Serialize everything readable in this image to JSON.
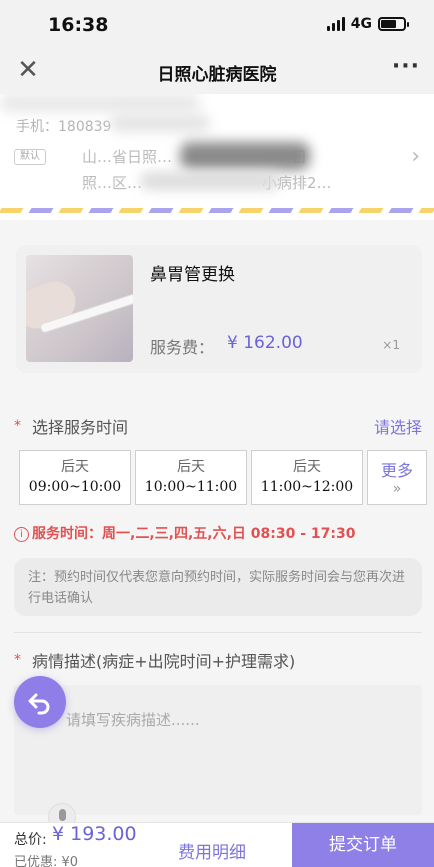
{
  "status_bar": {
    "time": "16:38",
    "network": "4G"
  },
  "nav": {
    "title": "日照心脏病医院",
    "more": "···",
    "close": "✕"
  },
  "address": {
    "phone": "手机：180839",
    "tag": "默认",
    "line1": "山…省日照…　　　　　　　　日",
    "line2": "照…区…　　　　　　　　小病排2…"
  },
  "service": {
    "name": "鼻胃管更换",
    "fee_label": "服务费：",
    "fee_value": "¥ 162.00",
    "quantity": "×1"
  },
  "time_section": {
    "title": "选择服务时间",
    "select": "请选择",
    "slots": [
      {
        "day": "后天",
        "time": "09:00~10:00"
      },
      {
        "day": "后天",
        "time": "10:00~11:00"
      },
      {
        "day": "后天",
        "time": "11:00~12:00"
      }
    ],
    "more_label": "更多",
    "more_arrow": "»"
  },
  "service_hours": {
    "icon": "i",
    "text": "服务时间：周一,二,三,四,五,六,日 08:30 - 17:30"
  },
  "notice": "注：预约时间仅代表您意向预约时间，实际服务时间会与您再次进行电话确认",
  "description": {
    "title": "病情描述(病症+出院时间+护理需求)",
    "placeholder": "请填写疾病描述......"
  },
  "bottom": {
    "total_label": "总价:",
    "total_value": "¥ 193.00",
    "discount": "已优惠: ¥0",
    "detail": "费用明细",
    "submit": "提交订单"
  },
  "colors": {
    "accent": "#7c76dc",
    "submit_bg": "#8e80e6",
    "required_star": "#e05050"
  }
}
